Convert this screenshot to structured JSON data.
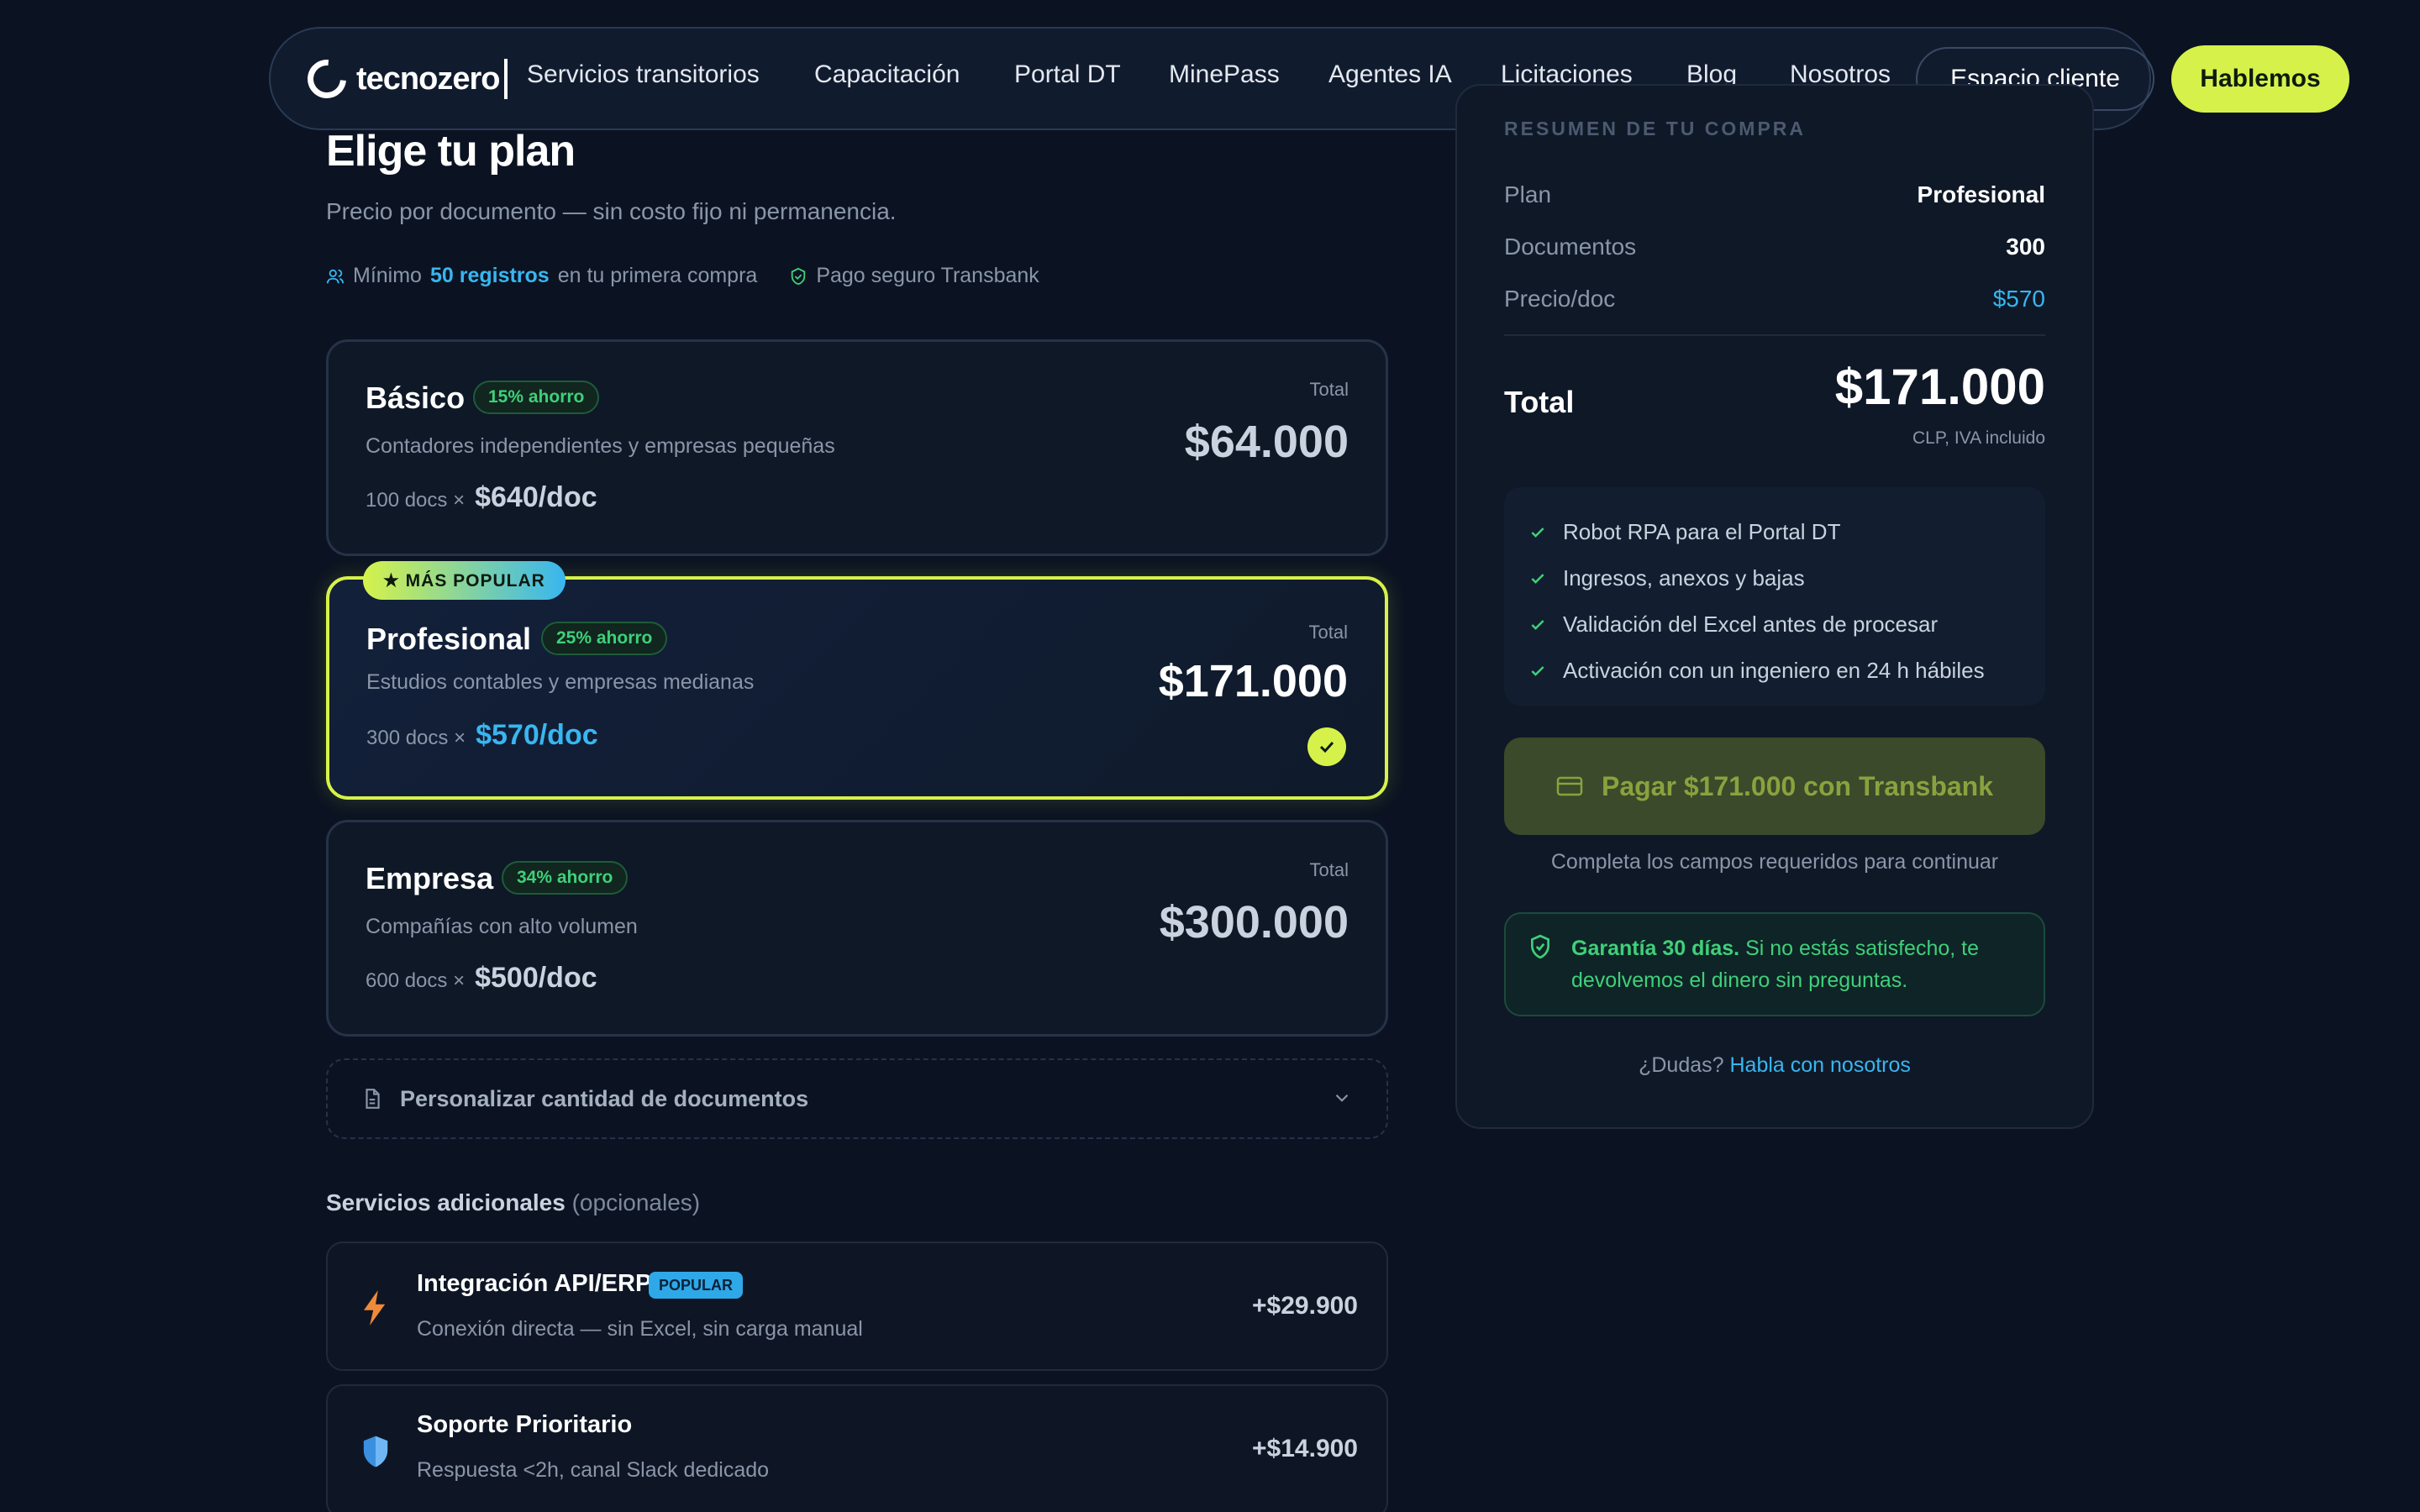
{
  "nav": {
    "brand": "tecnozero",
    "items": [
      "Servicios transitorios",
      "Capacitación",
      "Portal DT",
      "MinePass",
      "Agentes IA",
      "Licitaciones",
      "Blog",
      "Nosotros"
    ],
    "client_button": "Espacio cliente",
    "cta_button": "Hablemos"
  },
  "header": {
    "title": "Elige tu plan",
    "subtitle": "Precio por documento — sin costo fijo ni permanencia.",
    "min_prefix": "Mínimo",
    "min_highlight": "50 registros",
    "min_suffix": "en tu primera compra",
    "secure": "Pago seguro Transbank"
  },
  "plans": [
    {
      "name": "Básico",
      "saving": "15% ahorro",
      "desc": "Contadores independientes y empresas pequeñas",
      "docs": "100 docs ×",
      "per_doc": "$640/doc",
      "total_label": "Total",
      "total": "$64.000"
    },
    {
      "name": "Profesional",
      "saving": "25% ahorro",
      "desc": "Estudios contables y empresas medianas",
      "docs": "300 docs ×",
      "per_doc": "$570/doc",
      "total_label": "Total",
      "total": "$171.000",
      "popular": "★ MÁS POPULAR",
      "selected": true
    },
    {
      "name": "Empresa",
      "saving": "34% ahorro",
      "desc": "Compañías con alto volumen",
      "docs": "600 docs ×",
      "per_doc": "$500/doc",
      "total_label": "Total",
      "total": "$300.000"
    }
  ],
  "custom": {
    "label": "Personalizar cantidad de documentos"
  },
  "addons": {
    "title": "Servicios adicionales",
    "optional": "(opcionales)",
    "items": [
      {
        "name": "Integración API/ERP",
        "badge": "POPULAR",
        "desc": "Conexión directa — sin Excel, sin carga manual",
        "price": "+$29.900",
        "icon": "bolt-icon"
      },
      {
        "name": "Soporte Prioritario",
        "desc": "Respuesta <2h, canal Slack dedicado",
        "price": "+$14.900",
        "icon": "shield-icon"
      }
    ]
  },
  "summary": {
    "heading": "RESUMEN DE TU COMPRA",
    "rows": [
      {
        "k": "Plan",
        "v": "Profesional"
      },
      {
        "k": "Documentos",
        "v": "300"
      },
      {
        "k": "Precio/doc",
        "v": "$570"
      }
    ],
    "total_label": "Total",
    "total": "$171.000",
    "total_note": "CLP, IVA incluido",
    "features": [
      "Robot RPA para el Portal DT",
      "Ingresos, anexos y bajas",
      "Validación del Excel antes de procesar",
      "Activación con un ingeniero en 24 h hábiles"
    ],
    "pay_button": "Pagar $171.000 con Transbank",
    "pay_note": "Completa los campos requeridos para continuar",
    "guarantee_bold": "Garantía 30 días.",
    "guarantee_text": "Si no estás satisfecho, te devolvemos el dinero sin preguntas.",
    "help_q": "¿Dudas?",
    "help_link": "Habla con nosotros"
  },
  "colors": {
    "accent": "#d6f24a",
    "blue": "#38b6f0",
    "green": "#3fd07a",
    "bg": "#0b1322"
  }
}
